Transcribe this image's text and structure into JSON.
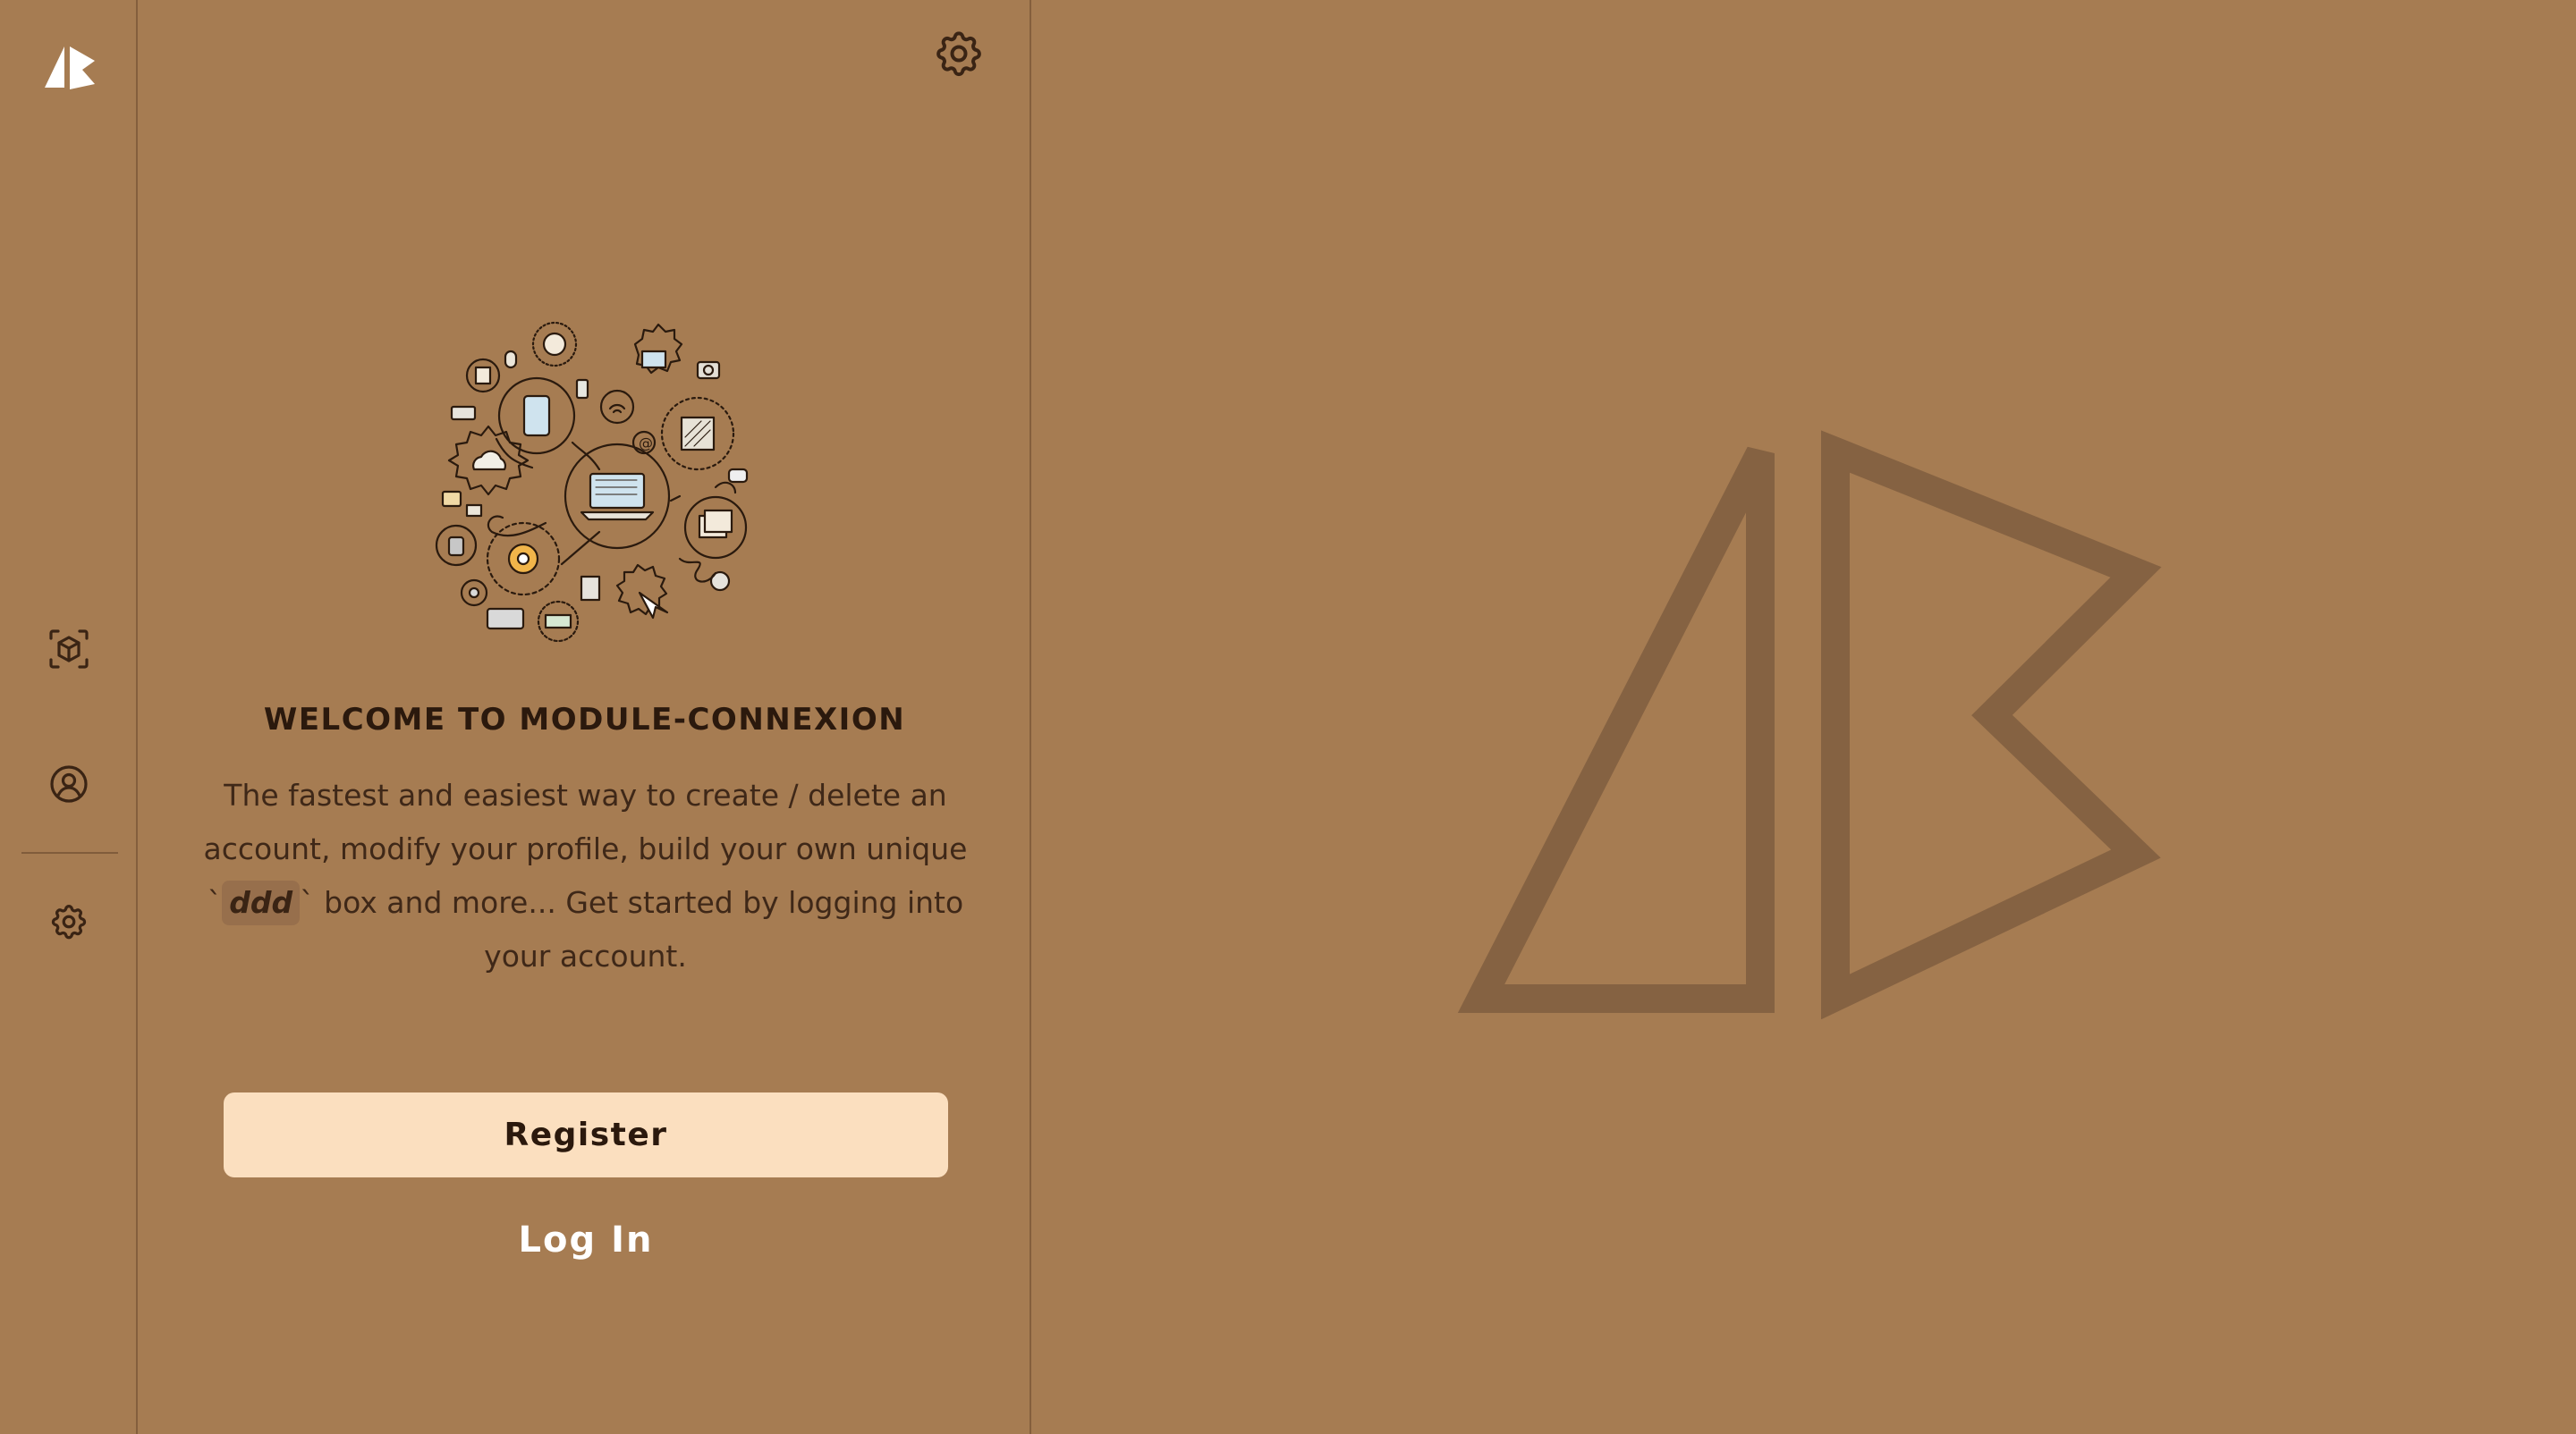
{
  "sidebar": {
    "logo_icon": "brand-logo-icon",
    "items": [
      {
        "icon": "cube-scan-icon",
        "label": "Box"
      },
      {
        "icon": "user-circle-icon",
        "label": "Profile"
      },
      {
        "icon": "gear-icon",
        "label": "Settings"
      }
    ]
  },
  "panel": {
    "settings_icon": "gear-icon",
    "illustration": "technology-doodle-illustration",
    "title": "WELCOME TO MODULE-CONNEXION",
    "description_before": "The fastest and easiest way to create / delete an account, modify your profile, build your own unique `",
    "description_code": "ddd",
    "description_after": "` box and more... Get started by logging into your account.",
    "register_label": "Register",
    "login_label": "Log In"
  },
  "hero": {
    "logo_icon": "brand-logo-outline-icon"
  },
  "colors": {
    "background": "#a67c52",
    "text_dark": "#2b190d",
    "button_bg": "#fbdfbf",
    "logo_stroke": "#856242"
  }
}
